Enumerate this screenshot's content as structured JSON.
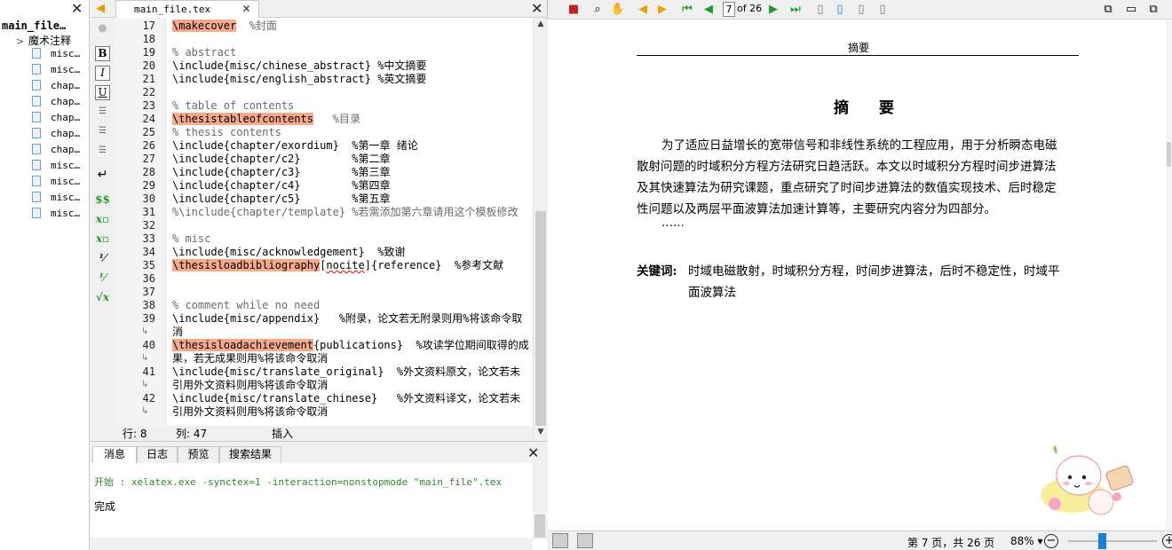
{
  "structure": {
    "root": "main_file…",
    "folder": "魔术注释",
    "items": [
      "misc…",
      "misc…",
      "chap…",
      "chap…",
      "chap…",
      "chap…",
      "chap…",
      "misc…",
      "misc…",
      "misc…",
      "misc…"
    ]
  },
  "editor": {
    "tab_label": "main_file.tex",
    "line_numbers": [
      "17",
      "18",
      "19",
      "20",
      "21",
      "22",
      "23",
      "24",
      "25",
      "26",
      "27",
      "28",
      "29",
      "30",
      "31",
      "32",
      "33",
      "34",
      "35",
      "36",
      "37",
      "38",
      "39",
      "40",
      "41",
      "42"
    ],
    "status": {
      "line_label": "行: 8",
      "col_label": "列: 47",
      "mode": "插入"
    }
  },
  "code": {
    "l17_kw": "\\makecover",
    "l17_cmt": "  %封面",
    "l19": "% abstract",
    "l20": "\\include{misc/chinese_abstract} %中文摘要",
    "l21": "\\include{misc/english_abstract} %英文摘要",
    "l23": "% table of contents",
    "l24_kw": "\\thesistableofcontents",
    "l24_cmt": "   %目录",
    "l25": "% thesis contents",
    "l26": "\\include{chapter/exordium}  %第一章 绪论",
    "l27": "\\include{chapter/c2}        %第二章",
    "l28": "\\include{chapter/c3}        %第三章",
    "l29": "\\include{chapter/c4}        %第四章",
    "l30": "\\include{chapter/c5}        %第五章",
    "l31": "%\\include{chapter/template} %若需添加第六章请用这个模板修改",
    "l33": "% misc",
    "l34": "\\include{misc/acknowledgement}  %致谢",
    "l35_kw": "\\thesisloadbibliography",
    "l35_a": "[",
    "l35_und": "nocite",
    "l35_b": "]{reference}  %参考文献",
    "l38": "% comment while no need",
    "l39a": "\\include{misc/appendix}   %附录，论文若无附录则用%将该命令取",
    "l39b": "消",
    "l40_kw": "\\thesisloadachievement",
    "l40a": "{publications}  %攻读学位期间取得的成",
    "l40b": "果，若无成果则用%将该命令取消",
    "l41a": "\\include{misc/translate_original}  %外文资料原文，论文若未",
    "l41b": "引用外文资料则用%将该命令取消",
    "l42a": "\\include{misc/translate_chinese}   %外文资料译文，论文若未",
    "l42b": "引用外文资料则用%将该命令取消"
  },
  "messages": {
    "tabs": [
      "消息",
      "日志",
      "预览",
      "搜索结果"
    ],
    "line1": "开始 : xelatex.exe -synctex=1 -interaction=nonstopmode \"main_file\".tex",
    "line2": "完成"
  },
  "pdf": {
    "page_input": "7",
    "page_of": "of 26",
    "header": "摘要",
    "title": "摘 要",
    "para": [
      "为了适应日益增长的宽带信号和非线性系统的工程应用，用于分析瞬态电磁",
      "散射问题的时域积分方程方法研究日趋活跃。本文以时域积分方程时间步进算法",
      "及其快速算法为研究课题，重点研究了时间步进算法的数值实现技术、后时稳定",
      "性问题以及两层平面波算法加速计算等，主要研究内容分为四部分。"
    ],
    "ellipsis": "……",
    "keywords_label": "关键词:",
    "keywords_1": "时域电磁散射，时域积分方程，时间步进算法，后时不稳定性，时域平",
    "keywords_2": "面波算法",
    "status_page": "第 7 页，共 26 页",
    "zoom": "88%"
  },
  "colors": {
    "highlight": "#f7a98c",
    "message_green": "#2a8a2a",
    "zoom_knob": "#1a7fd6"
  }
}
